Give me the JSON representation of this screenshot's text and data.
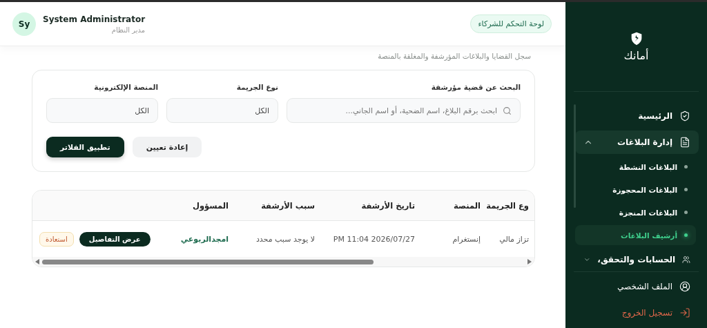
{
  "header": {
    "partner_button": "لوحة التحكم للشركاء",
    "user": {
      "initials": "Sy",
      "name": "System Administrator",
      "role": "مدير النظام"
    }
  },
  "page": {
    "subtitle": "سجل القضايا والبلاغات المؤرشفة والمغلقة بالمنصة"
  },
  "filters": {
    "fields": [
      {
        "kind": "search",
        "label": "البحث عن قضية مؤرشفة",
        "placeholder": "ابحث برقم البلاغ، اسم الضحية، أو اسم الجاني..."
      },
      {
        "kind": "select",
        "label": "نوع الجريمة",
        "value": "الكل"
      },
      {
        "kind": "select",
        "label": "المنصة الإلكترونية",
        "value": "الكل"
      }
    ],
    "buttons": [
      {
        "label": "إعادة تعيين",
        "kind": "secondary"
      },
      {
        "label": "تطبيق الفلاتر",
        "kind": "primary"
      }
    ]
  },
  "table": {
    "columns": [
      "وع الجريمة",
      "المنصة",
      "تاريخ الأرشفة",
      "سبب الأرشفة",
      "المسؤول"
    ],
    "rows": [
      {
        "cells": [
          "تزاز مالي",
          "إنستغرام",
          "2026/07/27 11:04 PM",
          "لا يوجد سبب محدد",
          "امجدالربوعي"
        ],
        "details_button": "عرض التفاصيل",
        "restore_button": "استعادة"
      }
    ]
  },
  "sidebar": {
    "logo_text": "أمانك",
    "items": [
      {
        "kind": "link",
        "label": "الرئيسية",
        "selected": false
      },
      {
        "kind": "group",
        "label": "إدارة البلاغات",
        "expanded": true,
        "selected": true,
        "children": [
          {
            "label": "البلاغات النشطة",
            "selected": false
          },
          {
            "label": "البلاغات المحجوزة",
            "selected": false
          },
          {
            "label": "البلاغات المنجزة",
            "selected": false
          },
          {
            "label": "أرشيف البلاغات",
            "selected": true
          }
        ]
      },
      {
        "kind": "group",
        "label": "الحسابات والتحقق،",
        "expanded": false,
        "selected": false
      }
    ],
    "bottom": [
      {
        "kind": "profile",
        "label": "الملف الشخصي"
      },
      {
        "kind": "logout",
        "label": "تسجيل الخروج"
      }
    ]
  }
}
